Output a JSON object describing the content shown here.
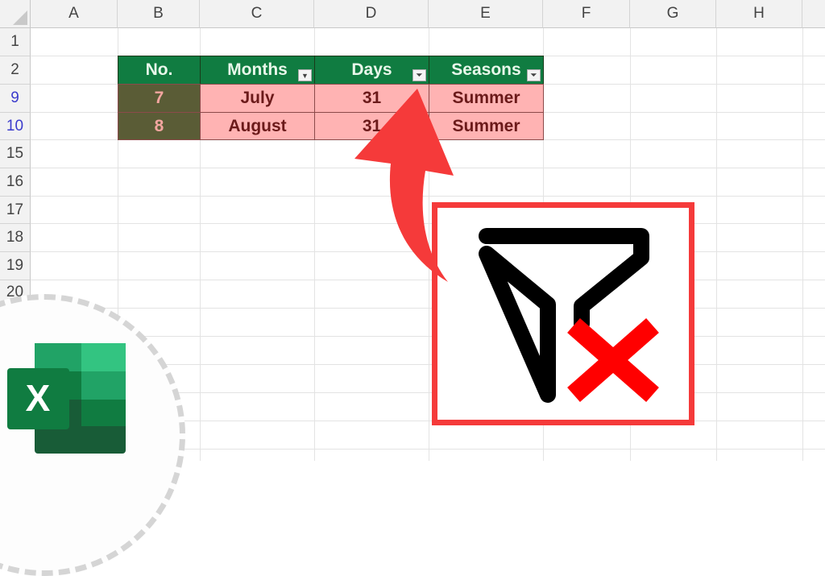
{
  "spreadsheet": {
    "column_headers": [
      "A",
      "B",
      "C",
      "D",
      "E",
      "F",
      "G",
      "H"
    ],
    "row_headers": [
      {
        "label": "1",
        "filtered": false
      },
      {
        "label": "2",
        "filtered": false
      },
      {
        "label": "9",
        "filtered": true
      },
      {
        "label": "10",
        "filtered": true
      },
      {
        "label": "15",
        "filtered": false
      },
      {
        "label": "16",
        "filtered": false
      },
      {
        "label": "17",
        "filtered": false
      },
      {
        "label": "18",
        "filtered": false
      },
      {
        "label": "19",
        "filtered": false
      },
      {
        "label": "20",
        "filtered": false
      }
    ],
    "table": {
      "headers": [
        {
          "label": "No.",
          "filter": "none"
        },
        {
          "label": "Months",
          "filter": "dropdown"
        },
        {
          "label": "Days",
          "filter": "filtered"
        },
        {
          "label": "Seasons",
          "filter": "filtered"
        }
      ],
      "rows": [
        [
          "7",
          "July",
          "31",
          "Summer"
        ],
        [
          "8",
          "August",
          "31",
          "Summer"
        ]
      ]
    }
  },
  "overlay": {
    "arrow_icon": "curved-arrow-up",
    "clear_filter_icon": "filter-remove",
    "app_logo": "excel-logo",
    "app_logo_letter": "X"
  },
  "colors": {
    "header_green": "#107c41",
    "row_pink": "#ffb3b3",
    "accent_red": "#f53a3a",
    "cross_red": "#ff0000"
  }
}
